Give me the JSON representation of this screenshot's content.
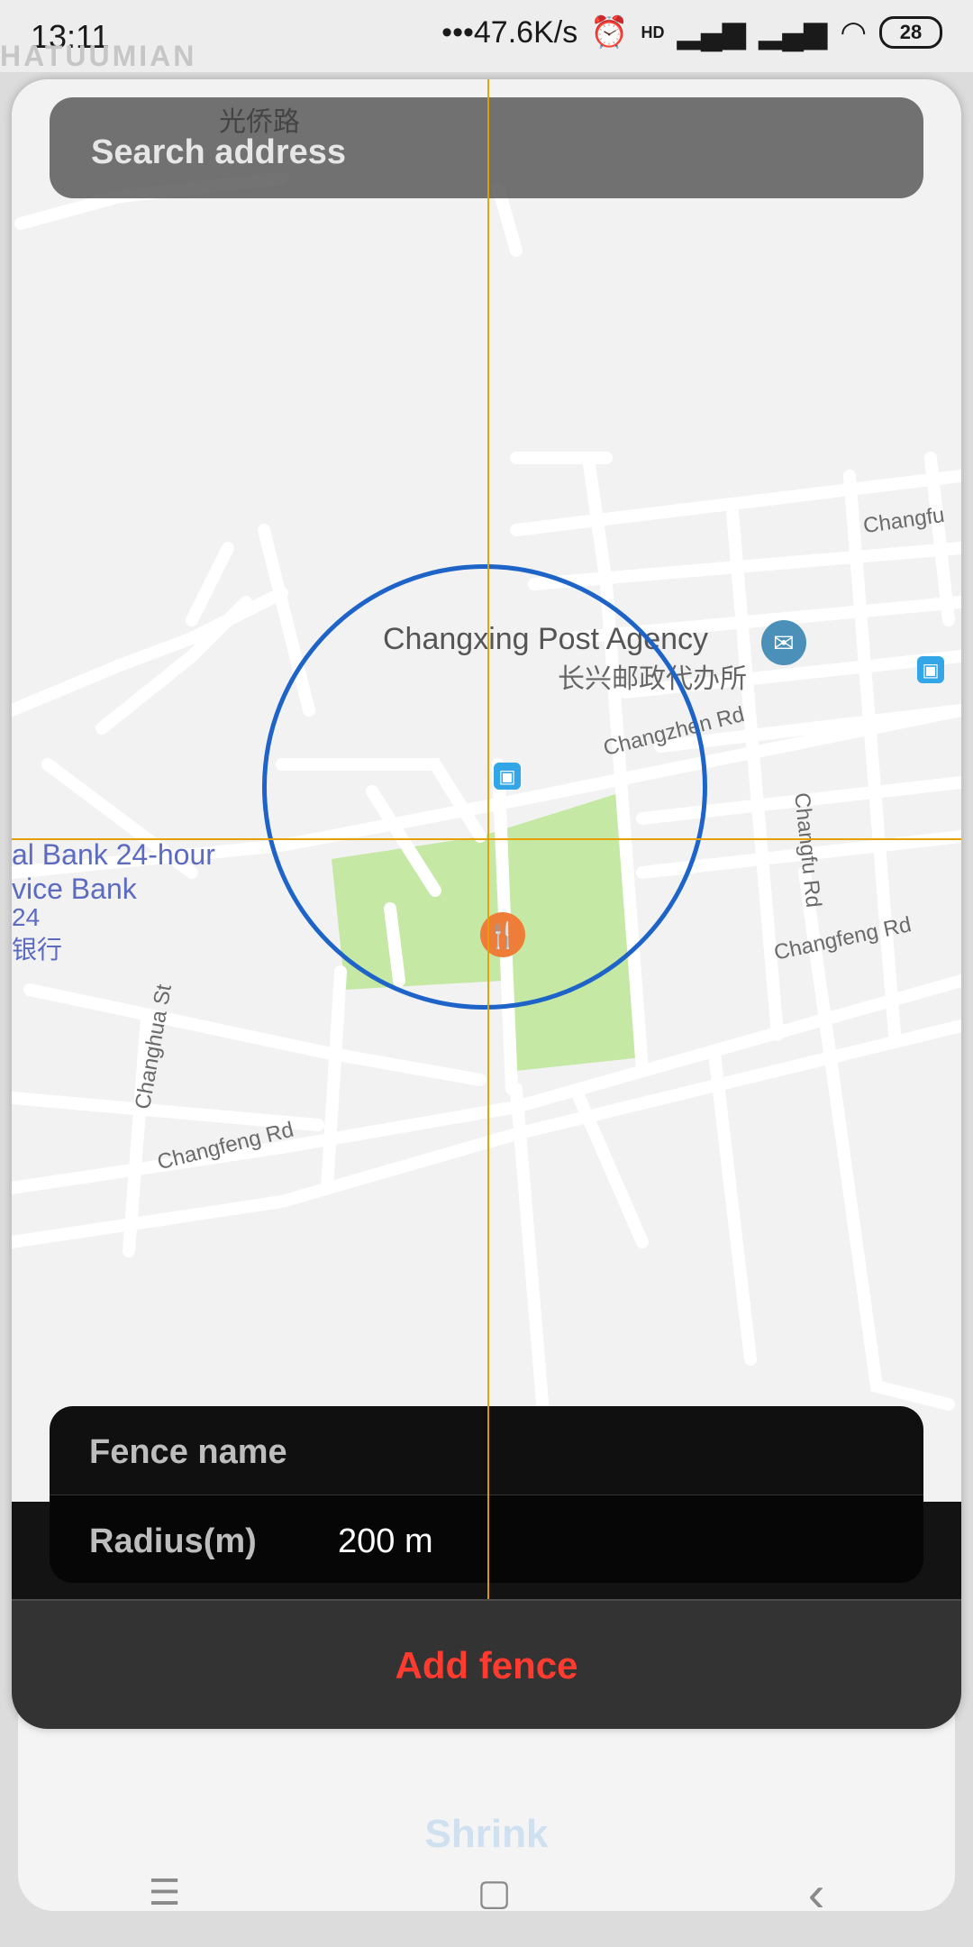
{
  "status_bar": {
    "time": "13:11",
    "network_speed": "47.6K/s",
    "hd_label": "HD",
    "battery": "28"
  },
  "background_label": "HATUUMIAN",
  "search": {
    "placeholder": "Search address",
    "map_road_label": "光侨路"
  },
  "map": {
    "poi_name": "Changxing Post Agency",
    "poi_name_cn": "长兴邮政代办所",
    "roads": {
      "changzhen": "Changzhen Rd",
      "changfu": "Changfu Rd",
      "changfu_top": "Changfu",
      "changfeng_right": "Changfeng Rd",
      "changfeng_left": "Changfeng Rd",
      "changhua": "Changhua St"
    },
    "bank_labels": [
      "al Bank 24-hour",
      "vice Bank",
      "24",
      "银行"
    ]
  },
  "form": {
    "fence_name_label": "Fence name",
    "fence_name_value": "",
    "radius_label": "Radius(m)",
    "radius_value": "200 m"
  },
  "actions": {
    "add_fence": "Add fence"
  },
  "background_sheet": {
    "shrink_label": "Shrink"
  },
  "nav_bar": {
    "menu_icon": "☰",
    "home_icon": "▢",
    "back_icon": "‹"
  },
  "colors": {
    "accent_red": "#ff3b30",
    "circle_blue": "#1e64c8",
    "crosshair": "#e5a000",
    "park_green": "#c5e8a5"
  }
}
